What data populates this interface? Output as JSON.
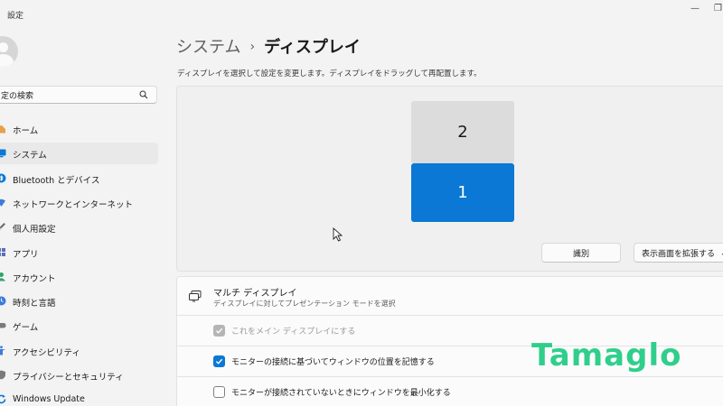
{
  "window": {
    "app_title": "設定",
    "min_glyph": "—",
    "max_glyph": "❐"
  },
  "sidebar": {
    "search": {
      "value": "定の検索",
      "icon": "search-icon"
    },
    "items": [
      {
        "label": "ホーム",
        "icon": "home-icon",
        "icon_color": "#e8a04a",
        "active": false
      },
      {
        "label": "システム",
        "icon": "monitor-icon",
        "icon_color": "#0a78d4",
        "active": true
      },
      {
        "label": "Bluetooth とデバイス",
        "icon": "bluetooth-icon",
        "icon_color": "#0a78d4",
        "active": false
      },
      {
        "label": "ネットワークとインターネット",
        "icon": "wifi-icon",
        "icon_color": "#3b7dd8",
        "active": false
      },
      {
        "label": "個人用設定",
        "icon": "brush-icon",
        "icon_color": "#6b6b6b",
        "active": false
      },
      {
        "label": "アプリ",
        "icon": "apps-icon",
        "icon_color": "#5a6fb8",
        "active": false
      },
      {
        "label": "アカウント",
        "icon": "account-icon",
        "icon_color": "#2fa36b",
        "active": false
      },
      {
        "label": "時刻と言語",
        "icon": "clock-icon",
        "icon_color": "#3b7dd8",
        "active": false
      },
      {
        "label": "ゲーム",
        "icon": "game-icon",
        "icon_color": "#7a7a7a",
        "active": false
      },
      {
        "label": "アクセシビリティ",
        "icon": "accessibility-icon",
        "icon_color": "#3b7dd8",
        "active": false
      },
      {
        "label": "プライバシーとセキュリティ",
        "icon": "shield-icon",
        "icon_color": "#7a7a7a",
        "active": false
      },
      {
        "label": "Windows Update",
        "icon": "update-icon",
        "icon_color": "#0a78d4",
        "active": false
      }
    ]
  },
  "main": {
    "breadcrumb": {
      "parent": "システム",
      "separator": "›",
      "current": "ディスプレイ"
    },
    "description": "ディスプレイを選択して設定を変更します。ディスプレイをドラッグして再配置します。",
    "monitors": [
      {
        "number": "2",
        "selected": false
      },
      {
        "number": "1",
        "selected": true
      }
    ],
    "identify_label": "識別",
    "extend_label": "表示画面を拡張する",
    "extend_chevron": "⌄",
    "multi_display": {
      "title": "マルチ ディスプレイ",
      "description": "ディスプレイに対してプレゼンテーション モードを選択",
      "options": [
        {
          "label": "これをメイン ディスプレイにする",
          "state": "disabled-checked"
        },
        {
          "label": "モニターの接続に基づいてウィンドウの位置を記憶する",
          "state": "checked"
        },
        {
          "label": "モニターが接続されていないときにウィンドウを最小化する",
          "state": "unchecked"
        }
      ]
    }
  },
  "watermark": "Tamaglo",
  "colors": {
    "accent": "#0a78d4",
    "watermark": "#2fcf8b"
  }
}
